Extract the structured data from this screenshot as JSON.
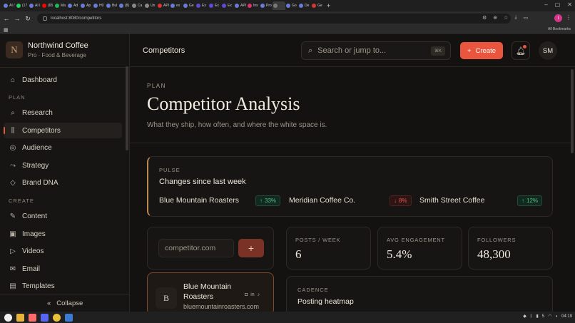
{
  "browser": {
    "tabs": [
      "AI /",
      "(17",
      "AI I",
      "(65",
      "Ma",
      "Ad",
      "Ap",
      "H0",
      "Bul",
      "(8)",
      "Ca",
      "Un",
      "API",
      "ex",
      "Ge",
      "Ex",
      "Ex",
      "Ex",
      "API",
      "Ins",
      "Pro",
      "",
      "Go",
      "De",
      "Ge"
    ],
    "url": "localhost:8080/competitors",
    "profile_initial": "I",
    "all_bookmarks": "All Bookmarks"
  },
  "brand": {
    "logo_letter": "N",
    "name": "Northwind Coffee",
    "plan": "Pro · Food & Beverage"
  },
  "sidebar": {
    "items_top": [
      {
        "label": "Dashboard",
        "icon": "home-icon"
      }
    ],
    "section_plan": "PLAN",
    "items_plan": [
      {
        "label": "Research",
        "icon": "search-icon"
      },
      {
        "label": "Competitors",
        "icon": "bar-chart-icon",
        "active": true
      },
      {
        "label": "Audience",
        "icon": "target-icon"
      },
      {
        "label": "Strategy",
        "icon": "route-icon"
      },
      {
        "label": "Brand DNA",
        "icon": "tag-icon"
      }
    ],
    "section_create": "CREATE",
    "items_create": [
      {
        "label": "Content",
        "icon": "pen-icon"
      },
      {
        "label": "Images",
        "icon": "image-icon"
      },
      {
        "label": "Videos",
        "icon": "video-icon"
      },
      {
        "label": "Email",
        "icon": "mail-icon"
      },
      {
        "label": "Templates",
        "icon": "template-icon"
      }
    ],
    "collapse_label": "Collapse"
  },
  "topbar": {
    "page": "Competitors",
    "search_placeholder": "Search or jump to...",
    "search_shortcut": "⌘K",
    "create_label": "Create",
    "avatar_initials": "SM"
  },
  "header": {
    "eyebrow": "PLAN",
    "title": "Competitor Analysis",
    "subtitle": "What they ship, how often, and where the white space is."
  },
  "pulse": {
    "eyebrow": "PULSE",
    "title": "Changes since last week",
    "competitors": [
      {
        "name": "Blue Mountain Roasters",
        "change": "33%",
        "direction": "up"
      },
      {
        "name": "Meridian Coffee Co.",
        "change": "8%",
        "direction": "down"
      },
      {
        "name": "Smith Street Coffee",
        "change": "12%",
        "direction": "up"
      }
    ]
  },
  "add_competitor": {
    "placeholder": "competitor.com",
    "button": "+"
  },
  "stats": [
    {
      "label": "POSTS / WEEK",
      "value": "6"
    },
    {
      "label": "AVG ENGAGEMENT",
      "value": "5.4%"
    },
    {
      "label": "FOLLOWERS",
      "value": "48,300"
    }
  ],
  "competitor_card": {
    "logo_letter": "B",
    "name": "Blue Mountain Roasters",
    "url": "bluemountainroasters.com",
    "socials": [
      "instagram-icon",
      "linkedin-icon",
      "tiktok-icon"
    ]
  },
  "cadence": {
    "eyebrow": "CADENCE",
    "title": "Posting heatmap"
  },
  "taskbar": {
    "time": "04:19",
    "tray_num": "5"
  },
  "colors": {
    "accent": "#e9553d",
    "up": "#58c08d",
    "down": "#e0584d",
    "highlight_border": "#b98a52"
  }
}
